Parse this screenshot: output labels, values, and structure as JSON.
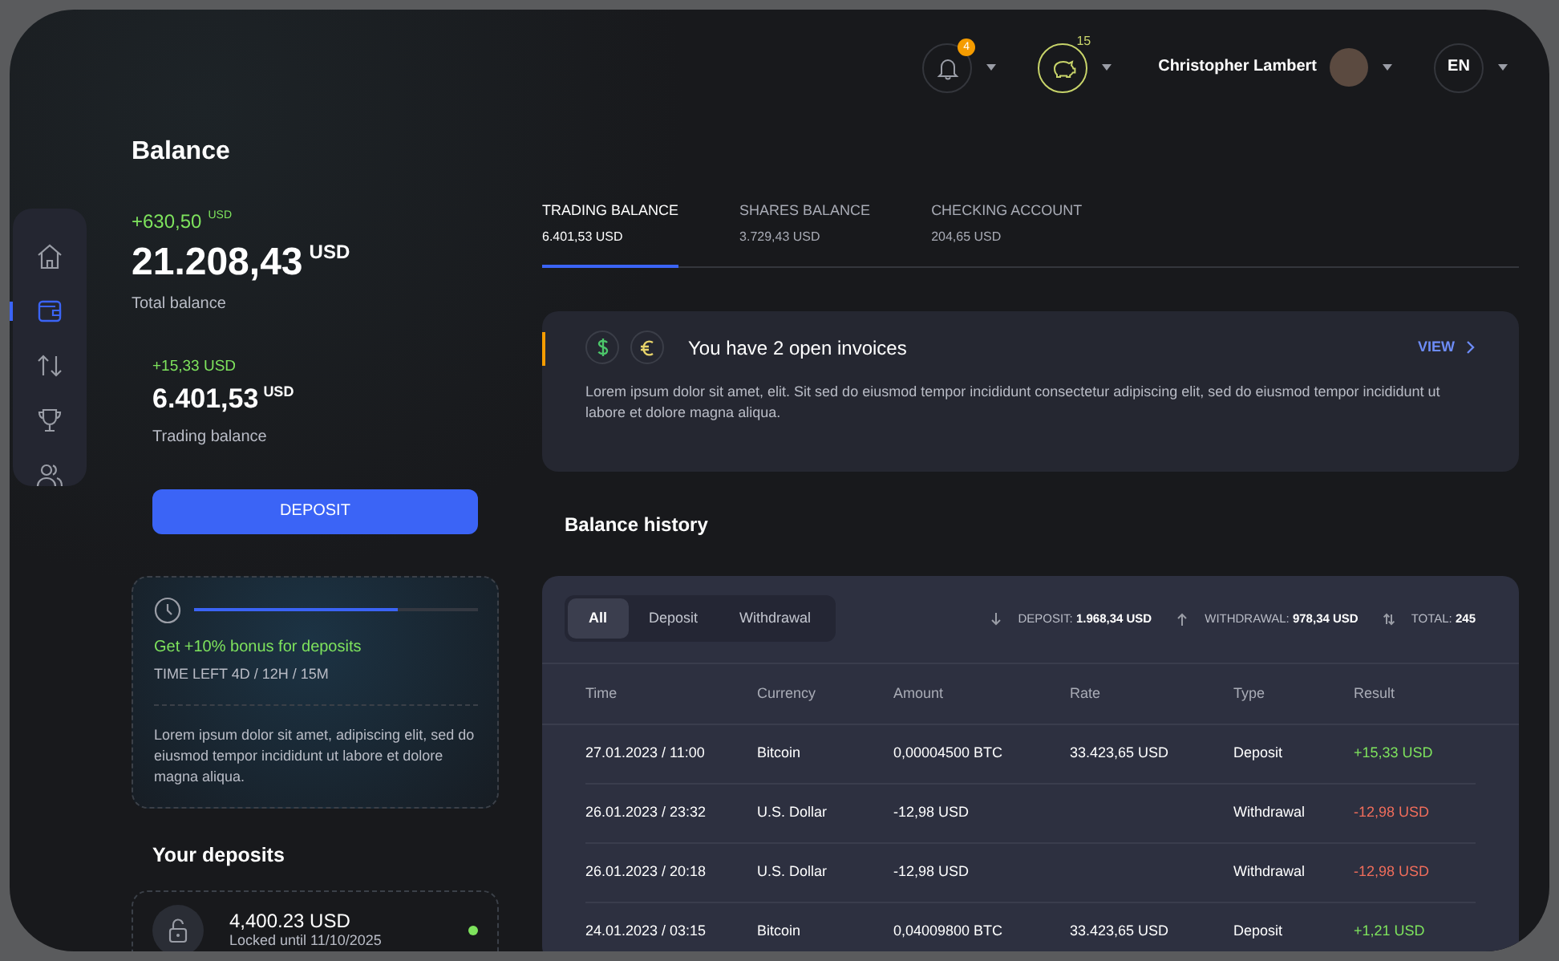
{
  "header": {
    "notifications": {
      "count": "4"
    },
    "coins": {
      "count": "15"
    },
    "user": {
      "name": "Christopher Lambert"
    },
    "language": "EN"
  },
  "sidebar": {
    "items": [
      {
        "kind": "home",
        "selected": false
      },
      {
        "kind": "wallet",
        "selected": true
      },
      {
        "kind": "transfer",
        "selected": false
      },
      {
        "kind": "trophy",
        "selected": false
      },
      {
        "kind": "users",
        "selected": false
      }
    ]
  },
  "balance": {
    "title": "Balance",
    "change": "+630,50",
    "change_unit": "USD",
    "total": "21.208,43",
    "total_unit": "USD",
    "total_label": "Total balance",
    "trading_change": "+15,33 USD",
    "trading": "6.401,53",
    "trading_unit": "USD",
    "trading_label": "Trading balance",
    "deposit_button": "DEPOSIT"
  },
  "bonus": {
    "level": 0.72,
    "title": "Get +10% bonus for deposits",
    "time_left": "TIME LEFT 4D / 12H / 15M",
    "text": "Lorem ipsum dolor sit amet,  adipiscing elit, sed do eiusmod tempor incididunt ut labore et dolore magna aliqua."
  },
  "deposits": {
    "title": "Your deposits",
    "items": [
      {
        "amount": "4,400.23 USD",
        "note": "Locked until 11/10/2025",
        "active": true
      }
    ]
  },
  "tabs": [
    {
      "label": "TRADING BALANCE",
      "value": "6.401,53 USD",
      "selected": true
    },
    {
      "label": "SHARES BALANCE",
      "value": "3.729,43 USD",
      "selected": false
    },
    {
      "label": "CHECKING ACCOUNT",
      "value": "204,65 USD",
      "selected": false
    }
  ],
  "invoices": {
    "title": "You have 2 open invoices",
    "text": "Lorem ipsum dolor sit amet, elit. Sit sed do eiusmod tempor incididunt consectetur adipiscing elit, sed do eiusmod tempor incididunt ut labore et dolore magna aliqua.",
    "link": "VIEW"
  },
  "history": {
    "title": "Balance history",
    "filters": [
      {
        "label": "All",
        "selected": true
      },
      {
        "label": "Deposit",
        "selected": false
      },
      {
        "label": "Withdrawal",
        "selected": false
      }
    ],
    "stats": [
      {
        "kind": "down",
        "label": "DEPOSIT:",
        "value": "1.968,34 USD"
      },
      {
        "kind": "up",
        "label": "WITHDRAWAL:",
        "value": "978,34 USD"
      },
      {
        "kind": "swap",
        "label": "TOTAL:",
        "value": "245"
      }
    ],
    "columns": [
      "Time",
      "Currency",
      "Amount",
      "Rate",
      "Type",
      "Result"
    ],
    "rows": [
      {
        "time": "27.01.2023 / 11:00",
        "currency": "Bitcoin",
        "amount": "0,00004500 BTC",
        "rate": "33.423,65 USD",
        "type": "Deposit",
        "result": "+15,33 USD",
        "positive": true
      },
      {
        "time": "26.01.2023 / 23:32",
        "currency": "U.S. Dollar",
        "amount": "-12,98 USD",
        "type": "Withdrawal",
        "result": "-12,98 USD",
        "positive": false
      },
      {
        "time": "26.01.2023 / 20:18",
        "currency": "U.S. Dollar",
        "amount": "-12,98 USD",
        "type": "Withdrawal",
        "result": "-12,98 USD",
        "positive": false
      },
      {
        "time": "24.01.2023 / 03:15",
        "currency": "Bitcoin",
        "amount": "0,04009800 BTC",
        "rate": "33.423,65 USD",
        "type": "Deposit",
        "result": "+1,21 USD",
        "positive": true
      }
    ]
  }
}
